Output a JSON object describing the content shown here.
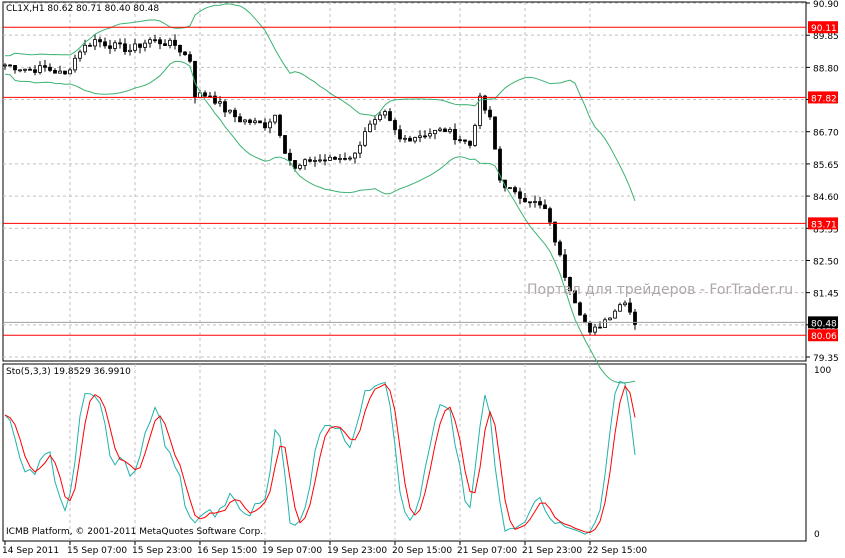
{
  "symbol_info": "CL1X,H1  80.62 80.71 80.40 80.48",
  "oscillator_info": "Sto(5,3,3) 19.8529 36.9910",
  "copyright": "ICMB Platform, © 2001-2011 MetaQuotes Software Corp.",
  "watermark": "Портал для трейдеров - ForTrader.ru",
  "price_scale": {
    "min": 79.35,
    "max": 90.9,
    "ticks": [
      "90.90",
      "89.85",
      "88.80",
      "87.75",
      "86.70",
      "85.65",
      "84.60",
      "83.55",
      "82.50",
      "81.45",
      "80.40",
      "79.35"
    ]
  },
  "osc_scale": {
    "top": "100",
    "bottom": "0"
  },
  "time_labels": [
    "14 Sep 2011",
    "15 Sep 07:00",
    "15 Sep 23:00",
    "16 Sep 15:00",
    "19 Sep 07:00",
    "19 Sep 23:00",
    "20 Sep 15:00",
    "21 Sep 07:00",
    "21 Sep 23:00",
    "22 Sep 15:00"
  ],
  "levels": [
    {
      "price": 90.11,
      "label": "90.11",
      "color": "#ff0000"
    },
    {
      "price": 87.82,
      "label": "87.82",
      "color": "#ff0000"
    },
    {
      "price": 83.71,
      "label": "83.71",
      "color": "#ff0000"
    },
    {
      "price": 80.06,
      "label": "80.06",
      "color": "#ff0000"
    }
  ],
  "current_price": {
    "price": 80.48,
    "label": "80.48"
  },
  "colors": {
    "band": "#3cb371",
    "k": "#20b2aa",
    "d": "#ff0000",
    "grid": "#c0c0c0"
  },
  "chart_data": {
    "type": "candlestick",
    "anchors": [
      [
        0,
        88.88
      ],
      [
        5,
        88.72
      ],
      [
        8,
        88.78
      ],
      [
        12,
        88.55
      ],
      [
        15,
        89.37
      ],
      [
        18,
        89.69
      ],
      [
        21,
        89.53
      ],
      [
        25,
        89.37
      ],
      [
        29,
        89.69
      ],
      [
        34,
        89.53
      ],
      [
        37,
        89.04
      ],
      [
        38,
        87.9
      ],
      [
        41,
        87.9
      ],
      [
        44,
        87.41
      ],
      [
        47,
        87.09
      ],
      [
        52,
        86.92
      ],
      [
        54,
        87.25
      ],
      [
        56,
        86.11
      ],
      [
        58,
        85.46
      ],
      [
        61,
        85.78
      ],
      [
        65,
        85.78
      ],
      [
        70,
        85.94
      ],
      [
        72,
        86.76
      ],
      [
        76,
        87.25
      ],
      [
        79,
        86.43
      ],
      [
        83,
        86.6
      ],
      [
        88,
        86.76
      ],
      [
        93,
        86.27
      ],
      [
        95,
        87.74
      ],
      [
        97,
        87.09
      ],
      [
        99,
        85.13
      ],
      [
        102,
        84.64
      ],
      [
        105,
        84.48
      ],
      [
        108,
        84.15
      ],
      [
        110,
        83.17
      ],
      [
        112,
        82.03
      ],
      [
        114,
        81.22
      ],
      [
        117,
        80.08
      ],
      [
        119,
        80.4
      ],
      [
        122,
        80.9
      ],
      [
        124,
        81.22
      ],
      [
        126,
        80.48
      ]
    ],
    "indicators": [
      "Bollinger Bands(20,2)",
      "Stochastic(5,3,3)"
    ]
  }
}
